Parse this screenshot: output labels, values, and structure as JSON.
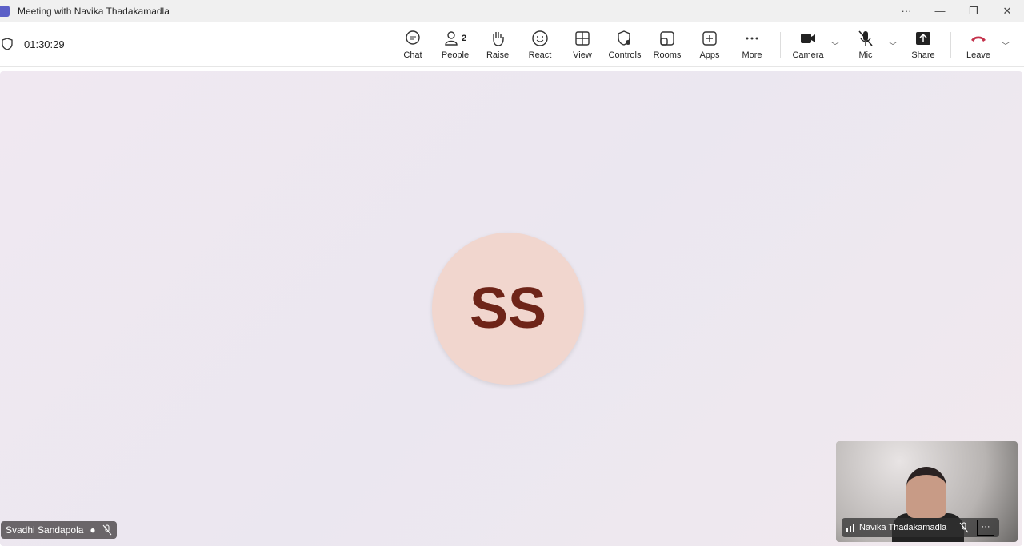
{
  "window": {
    "title": "Meeting with Navika Thadakamadla",
    "more": "···",
    "minimize": "—",
    "restore": "❐",
    "close": "✕"
  },
  "toolbar": {
    "timer": "01:30:29",
    "people_count": "2",
    "buttons": [
      {
        "label": "Chat",
        "icon": "chat-icon"
      },
      {
        "label": "People",
        "icon": "people-icon"
      },
      {
        "label": "Raise",
        "icon": "hand-icon"
      },
      {
        "label": "React",
        "icon": "smiley-icon"
      },
      {
        "label": "View",
        "icon": "grid-icon"
      },
      {
        "label": "Controls",
        "icon": "shield-gear-icon"
      },
      {
        "label": "Rooms",
        "icon": "rooms-icon"
      },
      {
        "label": "Apps",
        "icon": "plus-icon"
      },
      {
        "label": "More",
        "icon": "more-icon"
      },
      {
        "label": "Camera",
        "icon": "camera-icon"
      },
      {
        "label": "Mic",
        "icon": "mic-off-icon"
      },
      {
        "label": "Share",
        "icon": "share-icon"
      },
      {
        "label": "Leave",
        "icon": "phone-hangup-icon"
      }
    ]
  },
  "stage": {
    "avatar_initials": "SS",
    "participant_name": "Svadhi Sandapola"
  },
  "self_view": {
    "name": "Navika Thadakamadla",
    "more": "···"
  },
  "colors": {
    "leave": "#c4314b",
    "avatar_bg": "#f1d6ce",
    "avatar_text": "#6e2418"
  }
}
